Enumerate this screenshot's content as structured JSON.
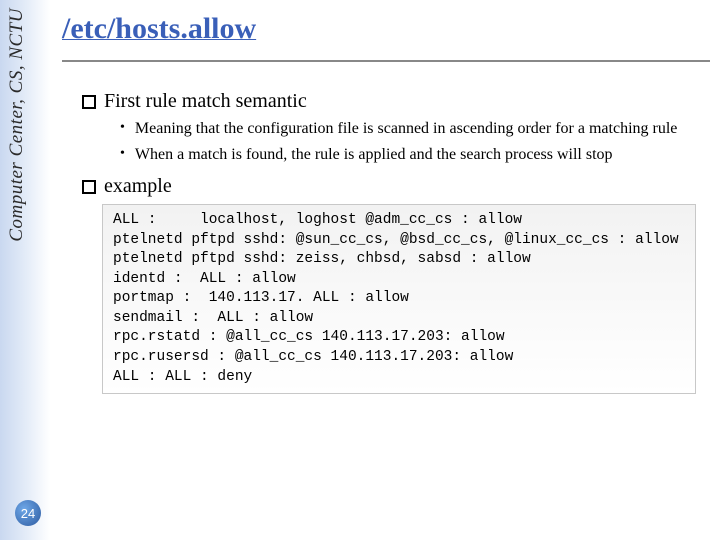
{
  "sidebar": {
    "org": "Computer Center, CS, NCTU",
    "page_number": "24"
  },
  "title": "/etc/hosts.allow",
  "sections": [
    {
      "heading": "First rule match semantic",
      "bullets": [
        "Meaning that the configuration file is scanned in ascending order for a matching rule",
        "When a match is found, the rule is applied and the search process will stop"
      ]
    },
    {
      "heading": "example"
    }
  ],
  "code": "ALL :     localhost, loghost @adm_cc_cs : allow\nptelnetd pftpd sshd: @sun_cc_cs, @bsd_cc_cs, @linux_cc_cs : allow\nptelnetd pftpd sshd: zeiss, chbsd, sabsd : allow\nidentd :  ALL : allow\nportmap :  140.113.17. ALL : allow\nsendmail :  ALL : allow\nrpc.rstatd : @all_cc_cs 140.113.17.203: allow\nrpc.rusersd : @all_cc_cs 140.113.17.203: allow\nALL : ALL : deny"
}
